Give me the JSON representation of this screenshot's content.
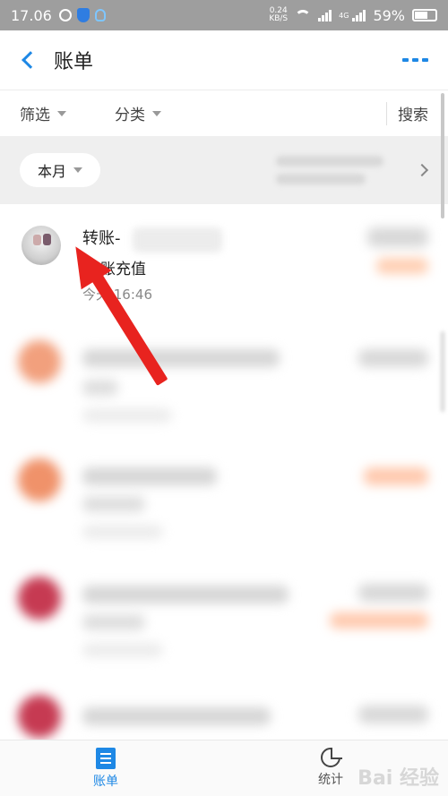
{
  "status_bar": {
    "time": "17.06",
    "net_speed_value": "0.24",
    "net_speed_unit": "KB/S",
    "signal_label": "4G",
    "battery": "59%"
  },
  "header": {
    "back_icon": "chevron-left-icon",
    "title": "账单",
    "more_icon": "more-icon"
  },
  "filters": {
    "filter_label": "筛选",
    "category_label": "分类",
    "search_label": "搜索"
  },
  "month": {
    "label": "本月"
  },
  "transactions": [
    {
      "title": "转账-",
      "subtitle": "账充值",
      "time": "今天 16:46"
    }
  ],
  "bottom_nav": {
    "bill_label": "账单",
    "stats_label": "统计"
  },
  "watermark": "Bai 经验",
  "colors": {
    "accent": "#1e88e5",
    "status_bar": "#9e9e9e",
    "arrow": "#e8231f"
  }
}
